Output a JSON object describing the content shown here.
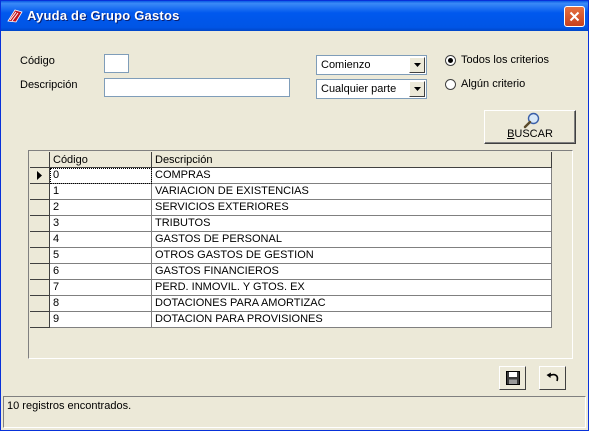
{
  "window": {
    "title": "Ayuda de Grupo Gastos"
  },
  "form": {
    "codigo_label": "Código",
    "codigo_value": "",
    "descripcion_label": "Descripción",
    "descripcion_value": "",
    "codigo_match": "Comienzo",
    "descripcion_match": "Cualquier parte",
    "radio_all": "Todos los criterios",
    "radio_any": "Algún criterio",
    "radio_selected": "all",
    "search_button": "BUSCAR"
  },
  "grid": {
    "columns": [
      "Código",
      "Descripción"
    ],
    "rows": [
      {
        "code": "0",
        "desc": "COMPRAS"
      },
      {
        "code": "1",
        "desc": "VARIACION DE EXISTENCIAS"
      },
      {
        "code": "2",
        "desc": "SERVICIOS EXTERIORES"
      },
      {
        "code": "3",
        "desc": "TRIBUTOS"
      },
      {
        "code": "4",
        "desc": "GASTOS DE PERSONAL"
      },
      {
        "code": "5",
        "desc": "OTROS GASTOS DE GESTION"
      },
      {
        "code": "6",
        "desc": "GASTOS FINANCIEROS"
      },
      {
        "code": "7",
        "desc": "PERD. INMOVIL. Y GTOS. EX"
      },
      {
        "code": "8",
        "desc": "DOTACIONES PARA AMORTIZAC"
      },
      {
        "code": "9",
        "desc": "DOTACION PARA PROVISIONES"
      }
    ],
    "selected_row": 0
  },
  "status": {
    "text": "10 registros encontrados."
  },
  "icons": {
    "window": "app-logo-icon",
    "close": "close-icon",
    "search": "magnifier-icon",
    "save": "floppy-disk-icon",
    "undo": "undo-arrow-icon",
    "row_pointer": "row-pointer-icon"
  },
  "colors": {
    "titlebar": "#0055e5",
    "close": "#d6522f",
    "face": "#ece9d8"
  }
}
